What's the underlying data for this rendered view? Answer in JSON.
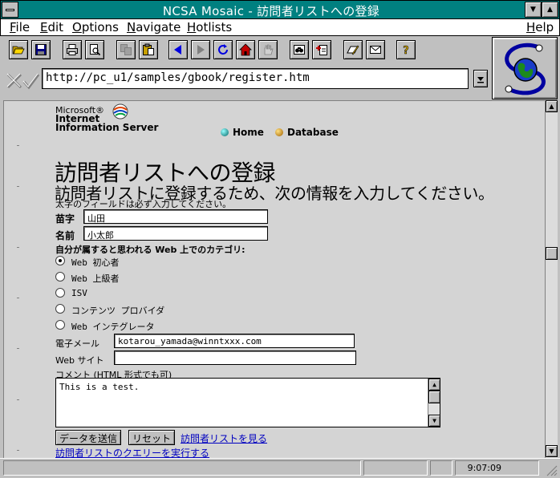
{
  "window": {
    "title": "NCSA Mosaic - 訪問者リストへの登録"
  },
  "menu": {
    "file": "File",
    "edit": "Edit",
    "options": "Options",
    "navigate": "Navigate",
    "hotlists": "Hotlists",
    "help": "Help"
  },
  "address": {
    "url": "http://pc_u1/samples/gbook/register.htm"
  },
  "page": {
    "logo_line1": "Microsoft®",
    "logo_line2": "Internet",
    "logo_line3": "Information Server",
    "nav_home": "Home",
    "nav_database": "Database",
    "heading": "訪問者リストへの登録",
    "subheading": "訪問者リストに登録するため、次の情報を入力してください。",
    "required_note": "太字のフィールドは必ず入力してください。",
    "form": {
      "last_name_label": "苗字",
      "last_name_value": "山田",
      "first_name_label": "名前",
      "first_name_value": "小太郎",
      "category_label": "自分が属すると思われる Web 上でのカテゴリ:",
      "categories": [
        {
          "label": "Web 初心者",
          "selected": true
        },
        {
          "label": "Web 上級者",
          "selected": false
        },
        {
          "label": "ISV",
          "selected": false
        },
        {
          "label": "コンテンツ プロバイダ",
          "selected": false
        },
        {
          "label": "Web インテグレータ",
          "selected": false
        }
      ],
      "email_label": "電子メール",
      "email_value": "kotarou_yamada@winntxxx.com",
      "website_label": "Web サイト",
      "website_value": "",
      "comment_label": "コメント (HTML 形式でも可)",
      "comment_value": "This is a test.",
      "submit_label": "データを送信",
      "reset_label": "リセット",
      "view_list_link": "訪問者リストを見る",
      "query_link": "訪問者リストのクエリーを実行する"
    }
  },
  "status": {
    "time": "9:07:09"
  }
}
